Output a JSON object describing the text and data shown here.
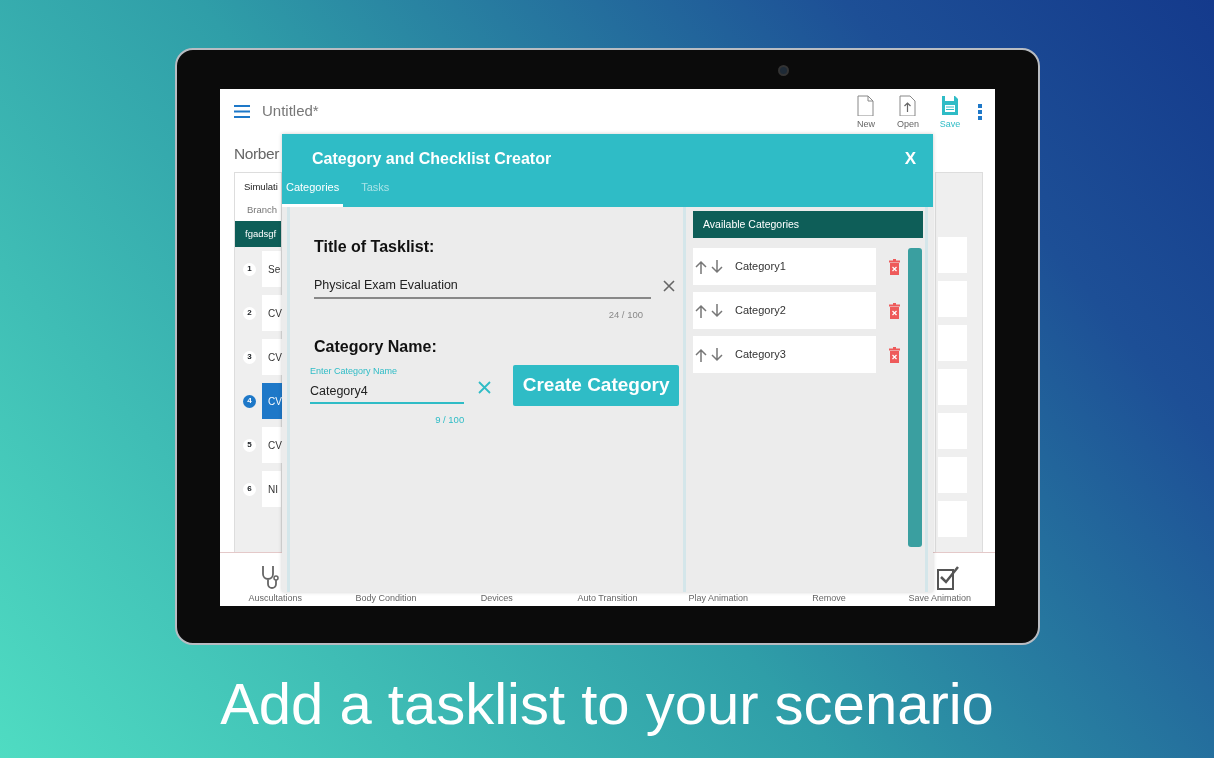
{
  "caption": "Add a tasklist to your scenario",
  "app": {
    "document_title": "Untitled*",
    "toolbar_actions": [
      {
        "label": "New",
        "kind": "new"
      },
      {
        "label": "Open",
        "kind": "open"
      },
      {
        "label": "Save",
        "kind": "save"
      }
    ],
    "heading": "Norber",
    "left_panel": {
      "tab": "Simulati",
      "subtab": "Branch",
      "header": "fgadsgf",
      "rows": [
        {
          "number": "1",
          "text": "Se",
          "selected": false
        },
        {
          "number": "2",
          "text": "CV",
          "selected": false
        },
        {
          "number": "3",
          "text": "CV",
          "selected": false
        },
        {
          "number": "4",
          "text": "CV",
          "selected": true
        },
        {
          "number": "5",
          "text": "CV",
          "selected": false
        },
        {
          "number": "6",
          "text": "NI",
          "selected": false
        }
      ]
    },
    "bottom_toolbar": [
      {
        "label": "Auscultations"
      },
      {
        "label": "Body Condition"
      },
      {
        "label": "Devices"
      },
      {
        "label": "Auto Transition"
      },
      {
        "label": "Play Animation"
      },
      {
        "label": "Remove"
      },
      {
        "label": "Save Animation"
      }
    ]
  },
  "dialog": {
    "title": "Category and Checklist Creator",
    "close": "X",
    "tabs": [
      {
        "label": "Categories",
        "selected": true
      },
      {
        "label": "Tasks",
        "selected": false
      }
    ],
    "tasklist_label": "Title of Tasklist:",
    "tasklist_value": "Physical Exam Evaluation",
    "tasklist_counter": "24 / 100",
    "category_label": "Category Name:",
    "category_placeholder": "Enter Category Name",
    "category_value": "Category4",
    "category_counter": "9 / 100",
    "create_button": "Create Category",
    "available_header": "Available Categories",
    "categories": [
      {
        "name": "Category1"
      },
      {
        "name": "Category2"
      },
      {
        "name": "Category3"
      }
    ]
  }
}
